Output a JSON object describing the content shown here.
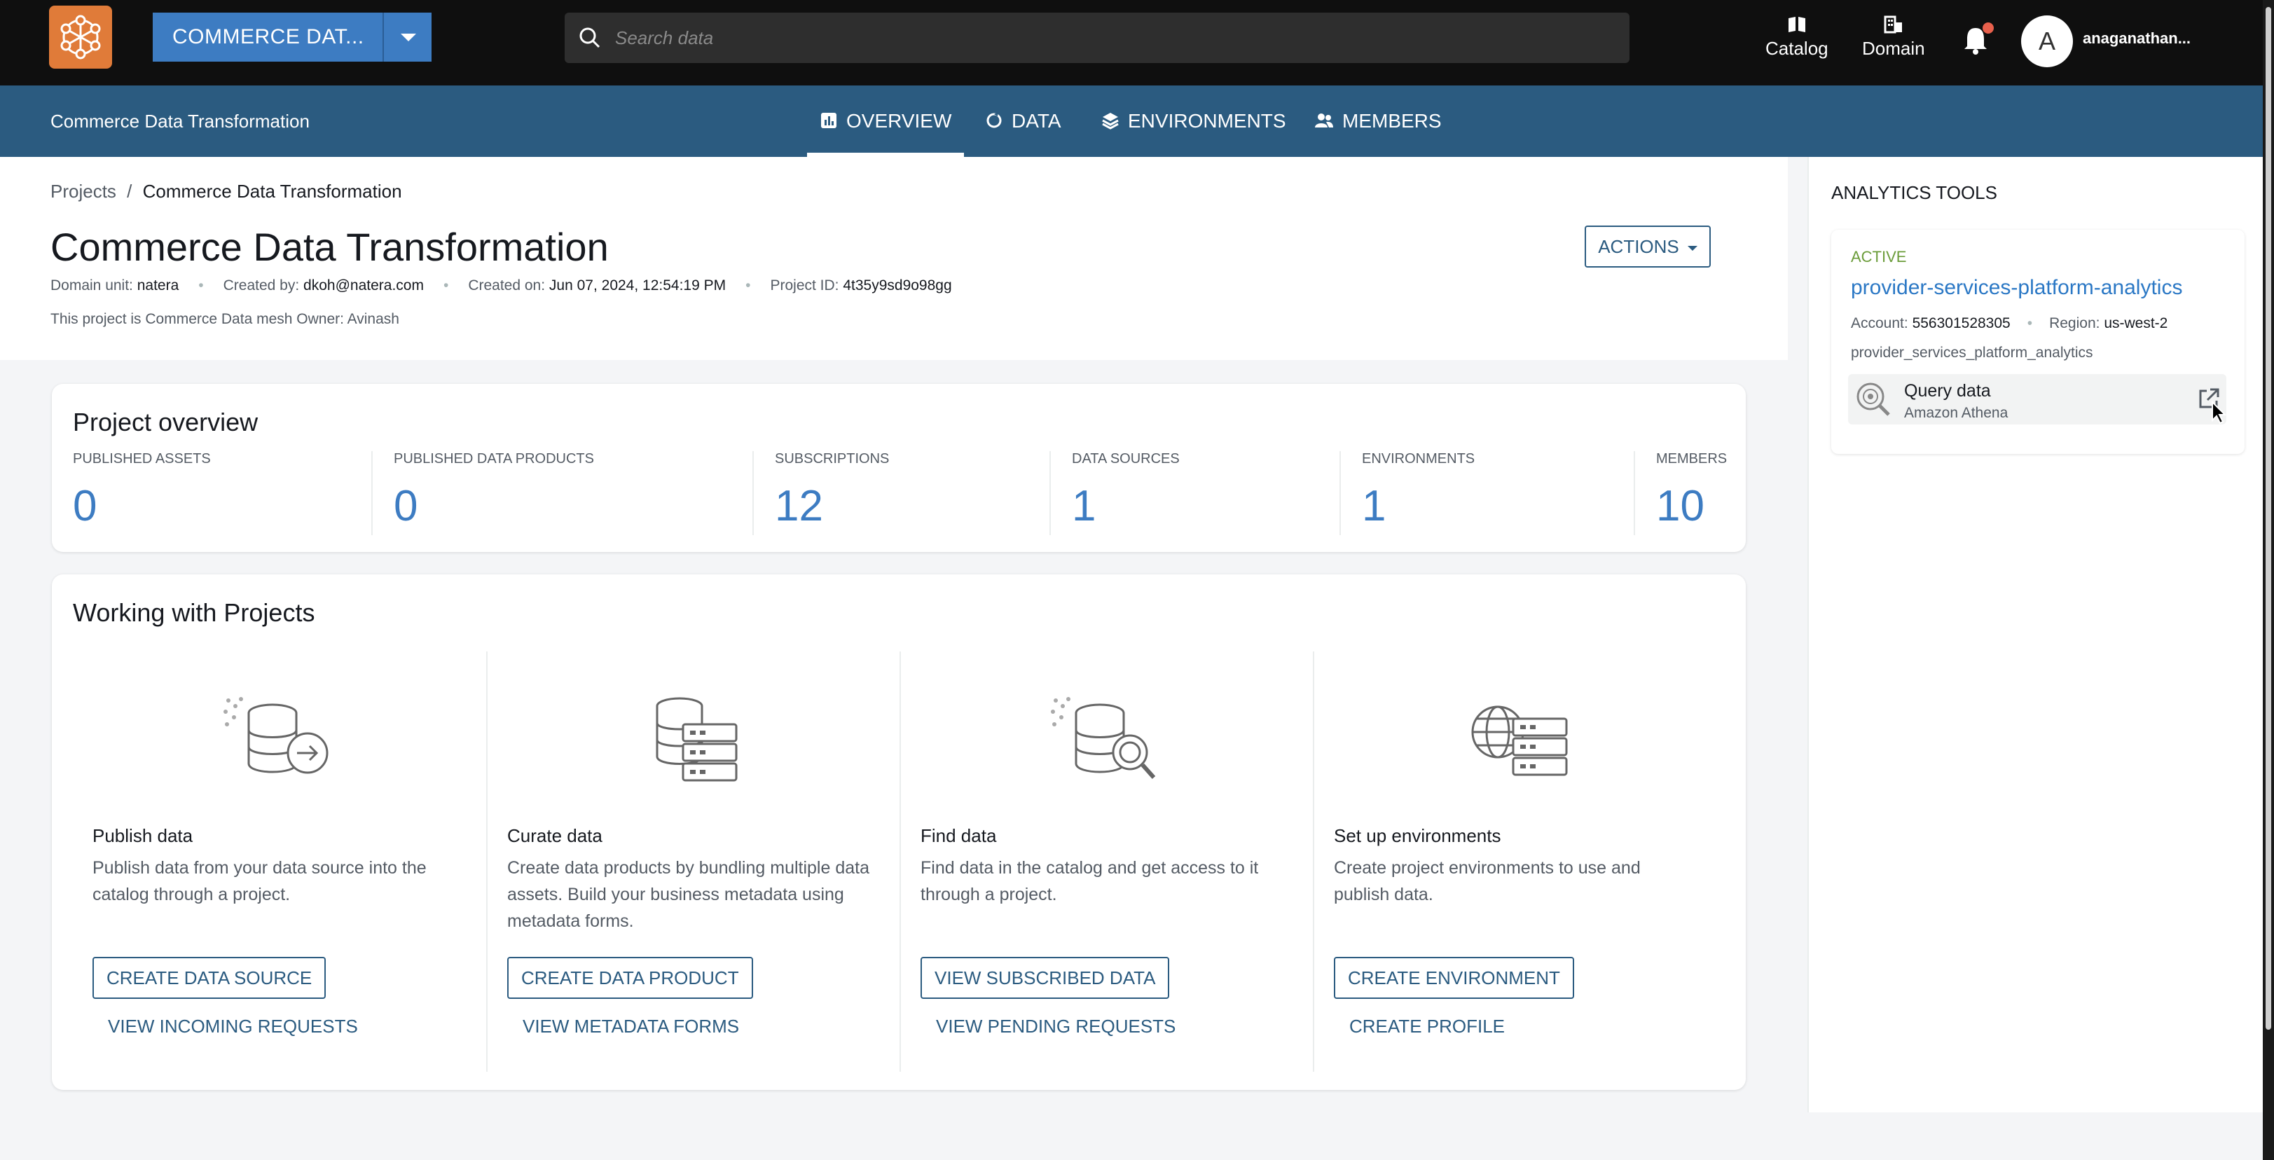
{
  "topbar": {
    "project_selector": "COMMERCE DAT...",
    "search_placeholder": "Search data",
    "nav": [
      {
        "label": "Catalog",
        "icon": "catalog-icon"
      },
      {
        "label": "Domain",
        "icon": "domain-icon"
      }
    ],
    "avatar_initial": "A",
    "username": "anaganathan..."
  },
  "subnav": {
    "title": "Commerce Data Transformation",
    "tabs": [
      {
        "label": "OVERVIEW",
        "icon": "overview-icon",
        "active": true
      },
      {
        "label": "DATA",
        "icon": "data-icon"
      },
      {
        "label": "ENVIRONMENTS",
        "icon": "environments-icon"
      },
      {
        "label": "MEMBERS",
        "icon": "members-icon"
      }
    ]
  },
  "header": {
    "breadcrumb": {
      "root": "Projects",
      "sep": "/",
      "current": "Commerce Data Transformation"
    },
    "title": "Commerce Data Transformation",
    "meta": {
      "domain_label": "Domain unit:",
      "domain_value": "natera",
      "created_by_label": "Created by:",
      "created_by_value": "dkoh@natera.com",
      "created_on_label": "Created on:",
      "created_on_value": "Jun 07, 2024, 12:54:19 PM",
      "project_id_label": "Project ID:",
      "project_id_value": "4t35y9sd9o98gg"
    },
    "description": "This project is Commerce Data mesh Owner: Avinash",
    "actions_label": "ACTIONS"
  },
  "overview": {
    "title": "Project overview",
    "stats": [
      {
        "label": "PUBLISHED ASSETS",
        "value": "0"
      },
      {
        "label": "PUBLISHED DATA PRODUCTS",
        "value": "0"
      },
      {
        "label": "SUBSCRIPTIONS",
        "value": "12"
      },
      {
        "label": "DATA SOURCES",
        "value": "1"
      },
      {
        "label": "ENVIRONMENTS",
        "value": "1"
      },
      {
        "label": "MEMBERS",
        "value": "10"
      }
    ]
  },
  "working": {
    "title": "Working with Projects",
    "columns": [
      {
        "title": "Publish data",
        "desc": "Publish data from your data source into the catalog through a project.",
        "button": "CREATE DATA SOURCE",
        "link": "VIEW INCOMING REQUESTS"
      },
      {
        "title": "Curate data",
        "desc": "Create data products by bundling multiple data assets. Build your business metadata using metadata forms.",
        "button": "CREATE DATA PRODUCT",
        "link": "VIEW METADATA FORMS"
      },
      {
        "title": "Find data",
        "desc": "Find data in the catalog and get access to it through a project.",
        "button": "VIEW SUBSCRIBED DATA",
        "link": "VIEW PENDING REQUESTS"
      },
      {
        "title": "Set up environments",
        "desc": "Create project environments to use and publish data.",
        "button": "CREATE ENVIRONMENT",
        "link": "CREATE PROFILE"
      }
    ]
  },
  "analytics": {
    "title": "ANALYTICS TOOLS",
    "status": "ACTIVE",
    "name": "provider-services-platform-analytics",
    "account_label": "Account:",
    "account_value": "556301528305",
    "region_label": "Region:",
    "region_value": "us-west-2",
    "database": "provider_services_platform_analytics",
    "query_label": "Query data",
    "query_sub": "Amazon Athena"
  },
  "colors": {
    "topbar": "#0f0f0f",
    "subnav": "#2b5b80",
    "accent": "#3d7cc2",
    "logo": "#e07b39",
    "active": "#6b9c3a"
  }
}
